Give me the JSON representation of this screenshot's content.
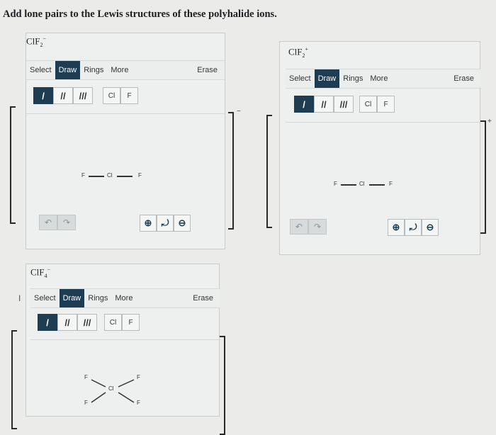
{
  "instruction": "Add lone pairs to the Lewis structures of these polyhalide ions.",
  "toolbar": {
    "select": "Select",
    "draw": "Draw",
    "rings": "Rings",
    "more": "More",
    "erase": "Erase"
  },
  "bonds": {
    "single": "/",
    "double": "//",
    "triple": "///"
  },
  "atoms": {
    "cl": "Cl",
    "f": "F"
  },
  "panel1": {
    "formula_base": "ClF",
    "formula_sub": "2",
    "formula_sup": "−",
    "molecule": {
      "left": "F",
      "center": "Cl",
      "right": "F"
    },
    "charge": "−"
  },
  "panel2": {
    "formula_base": "ClF",
    "formula_sub": "2",
    "formula_sup": "+",
    "molecule": {
      "left": "F",
      "center": "Cl",
      "right": "F"
    },
    "charge": "+"
  },
  "panel3": {
    "formula_base": "ClF",
    "formula_sub": "4",
    "formula_sup": "−",
    "molecule": {
      "f_top_left": "F",
      "f_top_right": "F",
      "center": "Cl",
      "f_bottom_left": "F",
      "f_bottom_right": "F"
    }
  },
  "icons": {
    "undo": "↶",
    "redo": "↷",
    "zoom_in": "⊕",
    "zoom_reset": "⤾",
    "zoom_out": "⊖",
    "text_cursor": "I"
  }
}
